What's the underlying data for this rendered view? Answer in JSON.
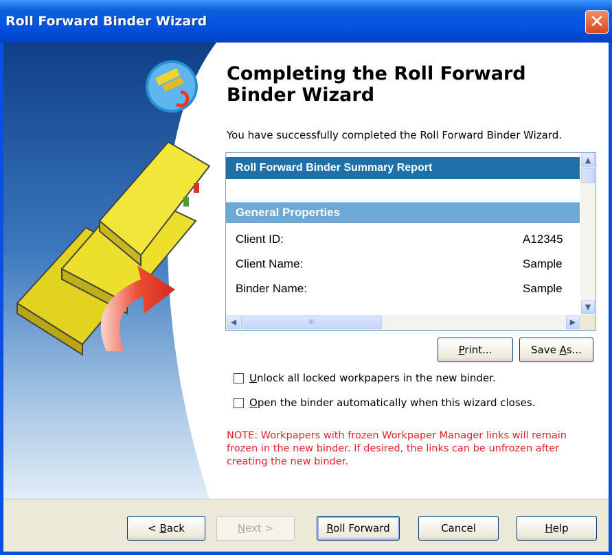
{
  "window": {
    "title": "Roll Forward Binder Wizard",
    "close_glyph": "✕"
  },
  "heading": "Completing the Roll Forward Binder Wizard",
  "success_text": "You have successfully completed the Roll Forward Binder Wizard.",
  "report": {
    "title": "Roll Forward Binder Summary Report",
    "section": "General Properties",
    "rows": [
      {
        "label": "Client ID:",
        "value": "A12345"
      },
      {
        "label": "Client Name:",
        "value": "Sample"
      },
      {
        "label": "Binder Name:",
        "value": "Sample"
      }
    ],
    "scroll_glyphs": {
      "up": "▲",
      "down": "▼",
      "left": "◀",
      "right": "▶",
      "grip": "III"
    }
  },
  "report_buttons": {
    "print": {
      "mnemonic": "P",
      "rest": "rint..."
    },
    "save_as": {
      "before": "Save ",
      "mnemonic": "A",
      "rest": "s..."
    }
  },
  "options": {
    "unlock": {
      "mnemonic": "U",
      "rest": "nlock all locked workpapers in the new binder.",
      "checked": false
    },
    "open_auto": {
      "mnemonic": "O",
      "rest": "pen the binder automatically when this wizard closes.",
      "checked": false
    }
  },
  "note": "NOTE: Workpapers with frozen Workpaper Manager links will remain frozen in the new binder. If desired, the links can be unfrozen after creating the new binder.",
  "footer": {
    "back": {
      "before": "< ",
      "mnemonic": "B",
      "rest": "ack"
    },
    "next": {
      "mnemonic": "N",
      "rest": "ext >",
      "disabled": true
    },
    "roll_forward": {
      "mnemonic": "R",
      "rest": "oll Forward"
    },
    "cancel": "Cancel",
    "help": {
      "mnemonic": "H",
      "rest": "elp"
    }
  },
  "colors": {
    "accent": "#0554e3",
    "report_header": "#1f6fa8",
    "section_header": "#6da9d6",
    "note": "#e0202d"
  }
}
